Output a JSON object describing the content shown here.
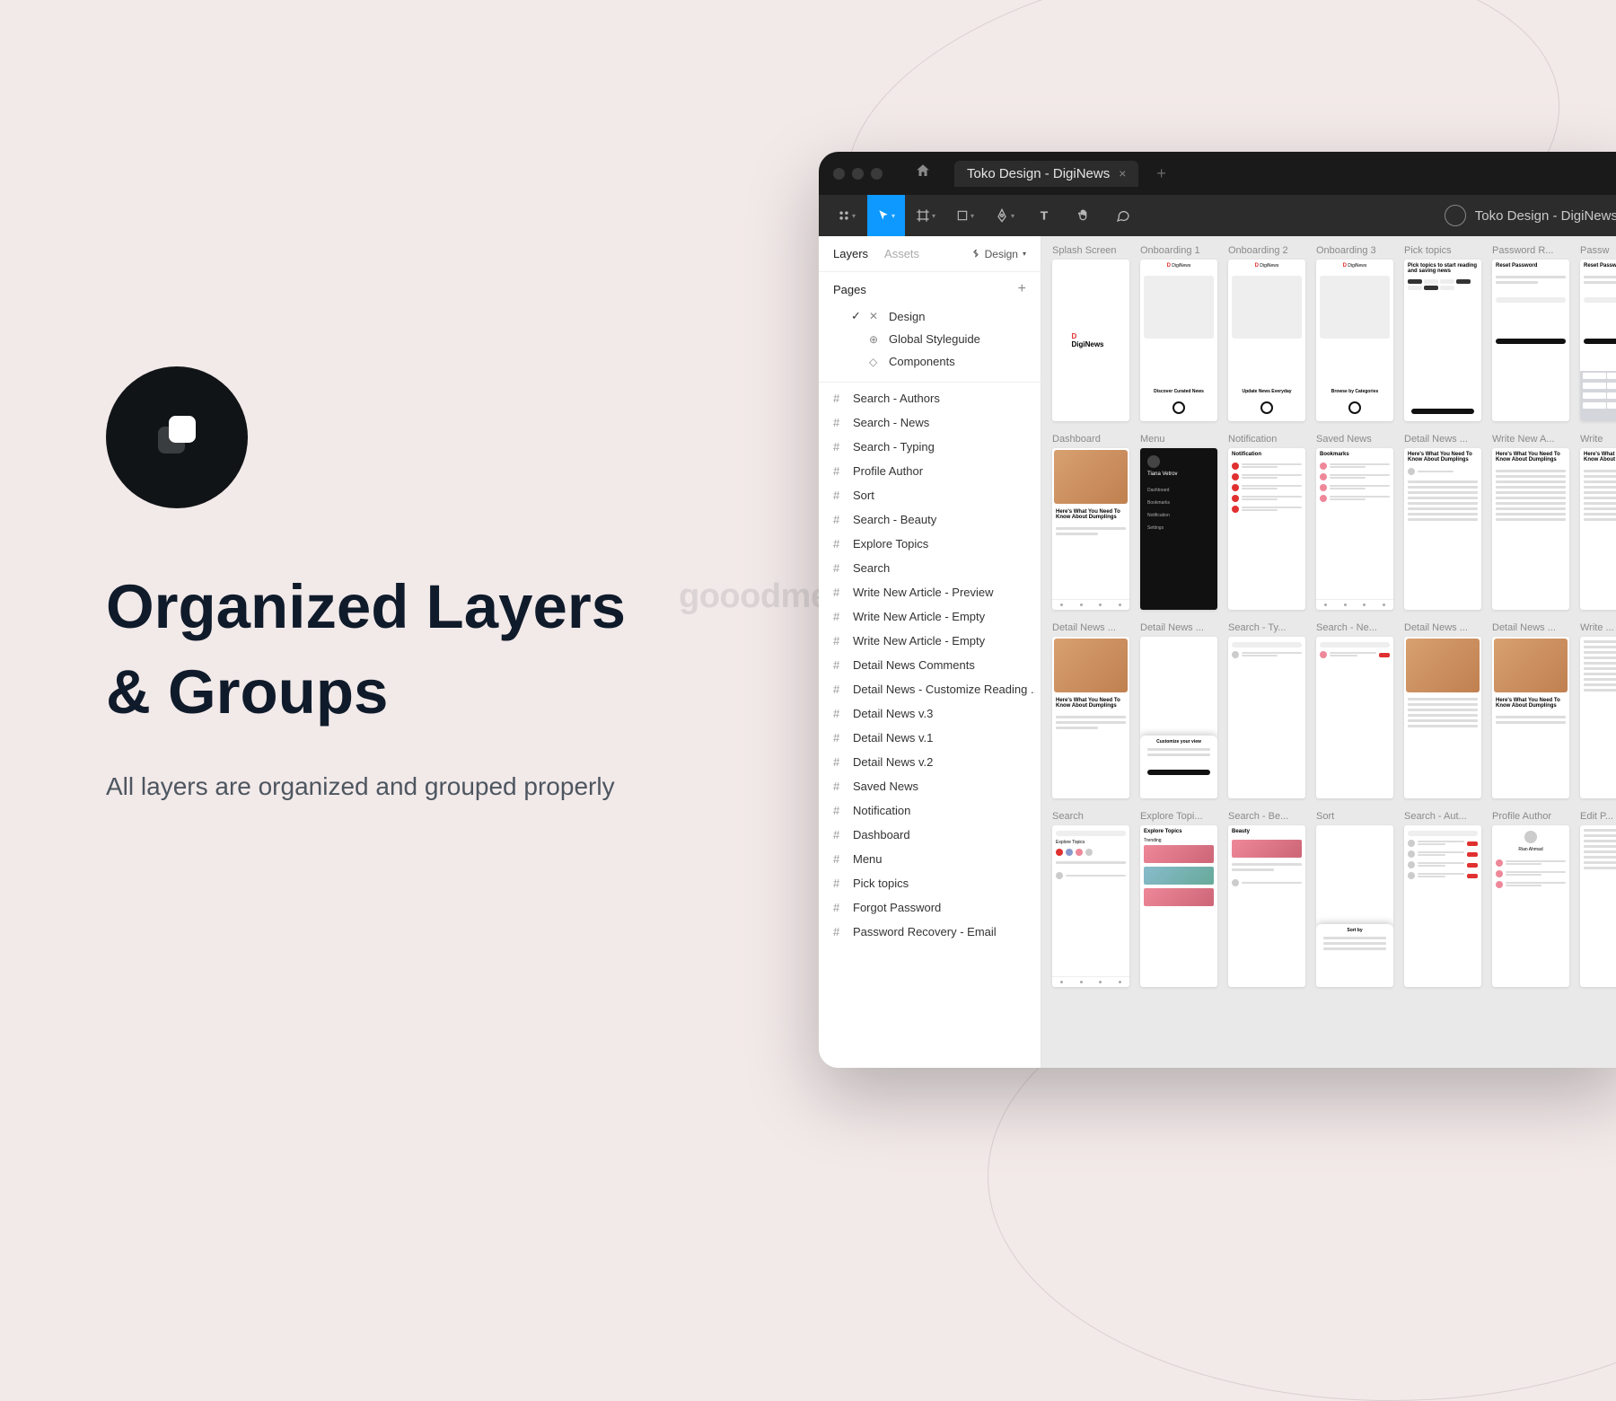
{
  "hero": {
    "title_l1": "Organized Layers",
    "title_l2": "& Groups",
    "subtitle": "All layers are organized and grouped properly"
  },
  "watermark": "gooodme.com",
  "figma": {
    "tab_title": "Toko Design - DigiNews",
    "project_name": "Toko Design - DigiNews",
    "panel_tabs": {
      "layers": "Layers",
      "assets": "Assets",
      "design": "Design"
    },
    "pages_label": "Pages",
    "pages": [
      {
        "name": "Design",
        "active": true,
        "icon": "✕"
      },
      {
        "name": "Global Styleguide",
        "active": false,
        "icon": "⊕"
      },
      {
        "name": "Components",
        "active": false,
        "icon": "◇"
      }
    ],
    "layers": [
      "Search - Authors",
      "Search - News",
      "Search - Typing",
      "Profile Author",
      "Sort",
      "Search - Beauty",
      "Explore Topics",
      "Search",
      "Write New Article - Preview",
      "Write New Article - Empty",
      "Write New Article - Empty",
      "Detail News Comments",
      "Detail News - Customize Reading ...",
      "Detail News v.3",
      "Detail News v.1",
      "Detail News v.2",
      "Saved News",
      "Notification",
      "Dashboard",
      "Menu",
      "Pick topics",
      "Forgot Password",
      "Password Recovery - Email"
    ],
    "canvas_rows": [
      [
        "Splash Screen",
        "Onboarding 1",
        "Onboarding 2",
        "Onboarding 3",
        "Pick topics",
        "Password R...",
        "Passw"
      ],
      [
        "Dashboard",
        "Menu",
        "Notification",
        "Saved News",
        "Detail News ...",
        "Write New A...",
        "Write"
      ],
      [
        "Detail News ...",
        "Detail News ...",
        "Search - Ty...",
        "Search - Ne...",
        "Detail News ...",
        "Detail News ...",
        "Write ..."
      ],
      [
        "Search",
        "Explore Topi...",
        "Search - Be...",
        "Sort",
        "Search - Aut...",
        "Profile Author",
        "Edit P..."
      ]
    ]
  }
}
